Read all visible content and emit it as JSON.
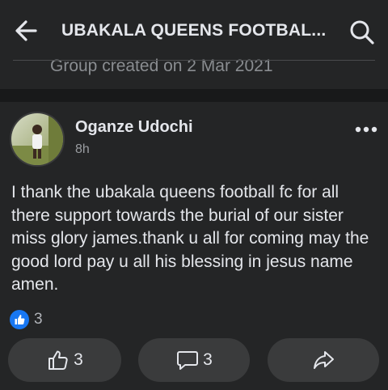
{
  "header": {
    "title": "UBAKALA QUEENS FOOTBAL...",
    "back_icon": "arrow-left-icon",
    "search_icon": "search-icon",
    "group_created": "Group created on 2 Mar 2021"
  },
  "post": {
    "author": "Oganze Udochi",
    "time": "8h",
    "text": "I thank the ubakala queens football fc for all there support towards the burial of our sister miss glory james.thank u all for coming may the good lord pay u all his blessing in jesus name amen.",
    "reaction_count": "3",
    "like_count": "3",
    "comment_count": "3"
  },
  "colors": {
    "background": "#242526",
    "separator": "#18191a",
    "button": "#3a3b3c",
    "like_blue": "#1877f2",
    "muted_text": "#8a8d91"
  }
}
